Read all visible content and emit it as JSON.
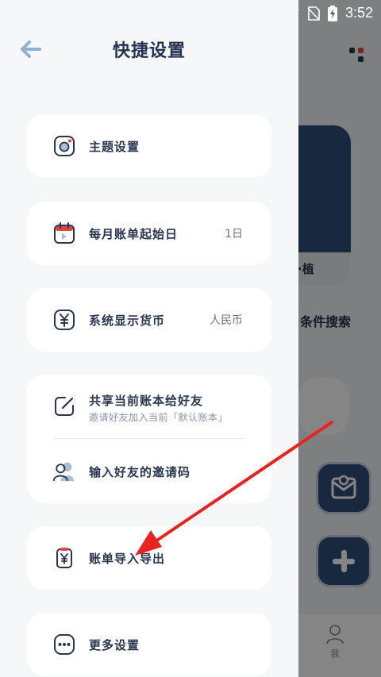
{
  "status_bar": {
    "time": "3:52"
  },
  "drawer": {
    "title": "快捷设置",
    "items": {
      "theme": {
        "label": "主题设置"
      },
      "billing_day": {
        "label": "每月账单起始日",
        "value": "1日"
      },
      "currency": {
        "label": "系统显示货币",
        "value": "人民币"
      },
      "share": {
        "label": "共享当前账本给好友",
        "sub": "邀请好友加入当前「默认账本」"
      },
      "invite_code": {
        "label": "输入好友的邀请码"
      },
      "import_export": {
        "label": "账单导入导出"
      },
      "more": {
        "label": "更多设置"
      }
    }
  },
  "background": {
    "card_label": "种·植",
    "search_label": "条件搜索",
    "tab_me": "我"
  },
  "colors": {
    "accent": "#2e4f79",
    "arrow": "#e8231f",
    "title": "#243250",
    "back_arrow": "#8fb0d0"
  }
}
